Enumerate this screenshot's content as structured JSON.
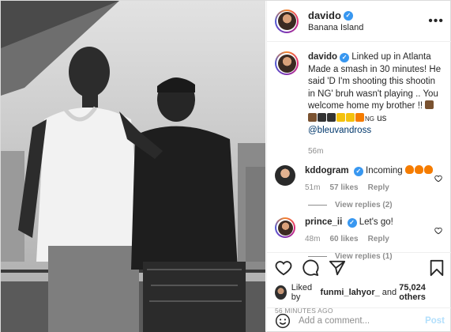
{
  "post": {
    "username": "davido",
    "location": "Banana Island",
    "more_icon": "more-icon",
    "caption_text": "Linked up in Atlanta Made a smash in 30 minutes! He said 'D I'm shooting this shootin in NG' bruh wasn't playing .. You welcome home my brother !! ",
    "caption_tail": "NG",
    "caption_us": " us ",
    "mention": "@bleuvandross",
    "caption_time": "56m"
  },
  "comments": [
    {
      "username": "kddogram",
      "text": "Incoming ",
      "time": "51m",
      "likes": "57 likes",
      "reply": "Reply",
      "view_replies": "View replies (2)"
    },
    {
      "username": "prince_ii",
      "text": "Let's go!",
      "time": "48m",
      "likes": "60 likes",
      "reply": "Reply",
      "view_replies": "View replies (1)"
    }
  ],
  "actions": {
    "liked_by_prefix": "Liked by ",
    "liked_by_user": "funmi_lahyor_",
    "liked_by_and": " and ",
    "liked_by_count": "75,024 others",
    "posted_time": "56 MINUTES AGO"
  },
  "add_comment": {
    "placeholder": "Add a comment...",
    "post_label": "Post"
  },
  "colors": {
    "link": "#00376b",
    "verified": "#3897f0",
    "muted": "#8e8e8e",
    "post_disabled": "#b2dffc"
  }
}
